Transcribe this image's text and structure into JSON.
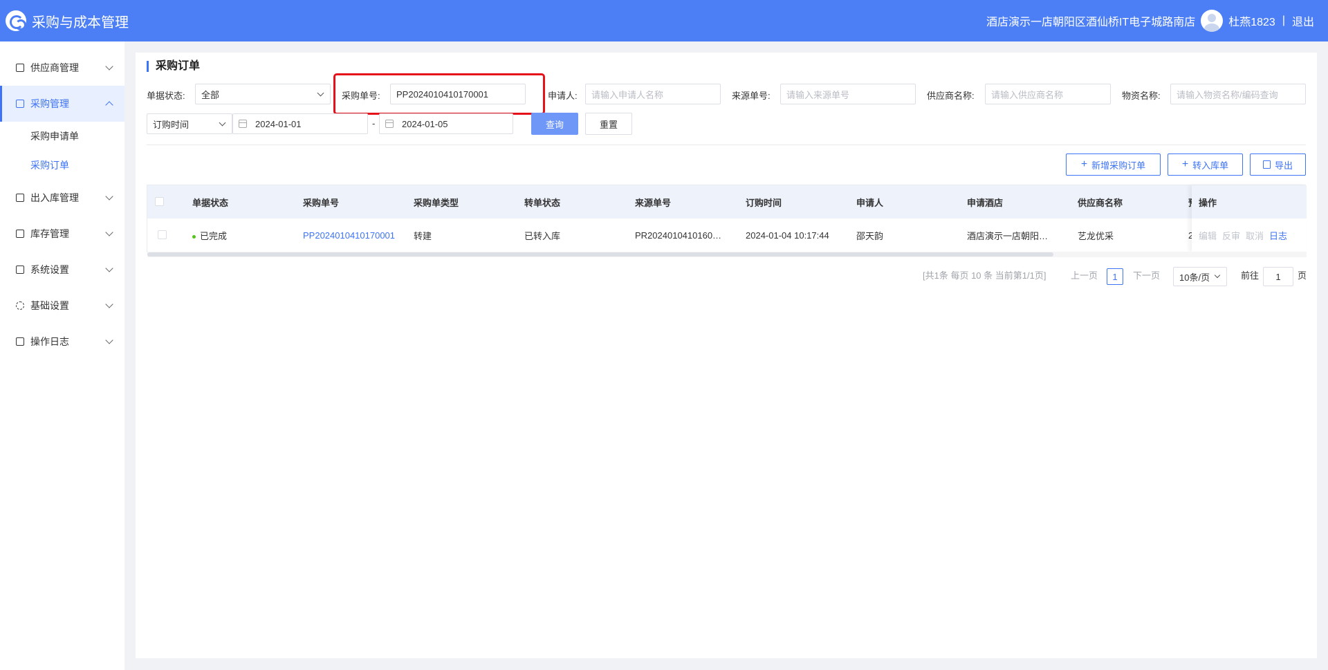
{
  "header": {
    "app_title": "采购与成本管理",
    "store_name": "酒店演示一店朝阳区酒仙桥IT电子城路南店",
    "user_name": "杜燕1823",
    "separator": "|",
    "logout_label": "退出",
    "brand_color": "#4c7ff5"
  },
  "sidebar": {
    "groups": [
      {
        "label": "供应商管理",
        "icon": "supplier-icon"
      },
      {
        "label": "采购管理",
        "icon": "purchase-icon",
        "expanded": true,
        "items": [
          {
            "label": "采购申请单"
          },
          {
            "label": "采购订单",
            "active": true
          }
        ]
      },
      {
        "label": "出入库管理",
        "icon": "inout-icon"
      },
      {
        "label": "库存管理",
        "icon": "inventory-icon"
      },
      {
        "label": "系统设置",
        "icon": "system-icon"
      },
      {
        "label": "基础设置",
        "icon": "gear-icon"
      },
      {
        "label": "操作日志",
        "icon": "log-icon"
      }
    ]
  },
  "page": {
    "title": "采购订单"
  },
  "filters": {
    "status_label": "单据状态:",
    "status_value": "全部",
    "order_no_label": "采购单号:",
    "order_no_value": "PP2024010410170001",
    "applicant_label": "申请人:",
    "applicant_placeholder": "请输入申请人名称",
    "source_no_label": "来源单号:",
    "source_no_placeholder": "请输入来源单号",
    "supplier_label": "供应商名称:",
    "supplier_placeholder": "请输入供应商名称",
    "material_label": "物资名称:",
    "material_placeholder": "请输入物资名称/编码查询",
    "time_type_value": "订购时间",
    "date_start": "2024-01-01",
    "date_sep": "-",
    "date_end": "2024-01-05",
    "query_label": "查询",
    "reset_label": "重置"
  },
  "actions": {
    "new_order_label": "新增采购订单",
    "to_stock_label": "转入库单",
    "export_label": "导出"
  },
  "table": {
    "columns": [
      "单据状态",
      "采购单号",
      "采购单类型",
      "转单状态",
      "来源单号",
      "订购时间",
      "申请人",
      "申请酒店",
      "供应商名称",
      "预",
      "操作"
    ],
    "rows": [
      {
        "status": "已完成",
        "order_no": "PP2024010410170001",
        "type": "转建",
        "transfer_status": "已转入库",
        "source_no": "PR2024010410160…",
        "order_time": "2024-01-04 10:17:44",
        "applicant": "邵天韵",
        "hotel": "酒店演示一店朝阳…",
        "supplier": "艺龙优采",
        "extra": "2",
        "ops": [
          "编辑",
          "反审",
          "取消",
          "日志"
        ]
      }
    ]
  },
  "pagination": {
    "summary": "[共1条 每页 10 条 当前第1/1页]",
    "prev_label": "上一页",
    "current_page": "1",
    "next_label": "下一页",
    "page_size": "10条/页",
    "goto_label": "前往",
    "goto_value": "1",
    "page_suffix": "页"
  }
}
